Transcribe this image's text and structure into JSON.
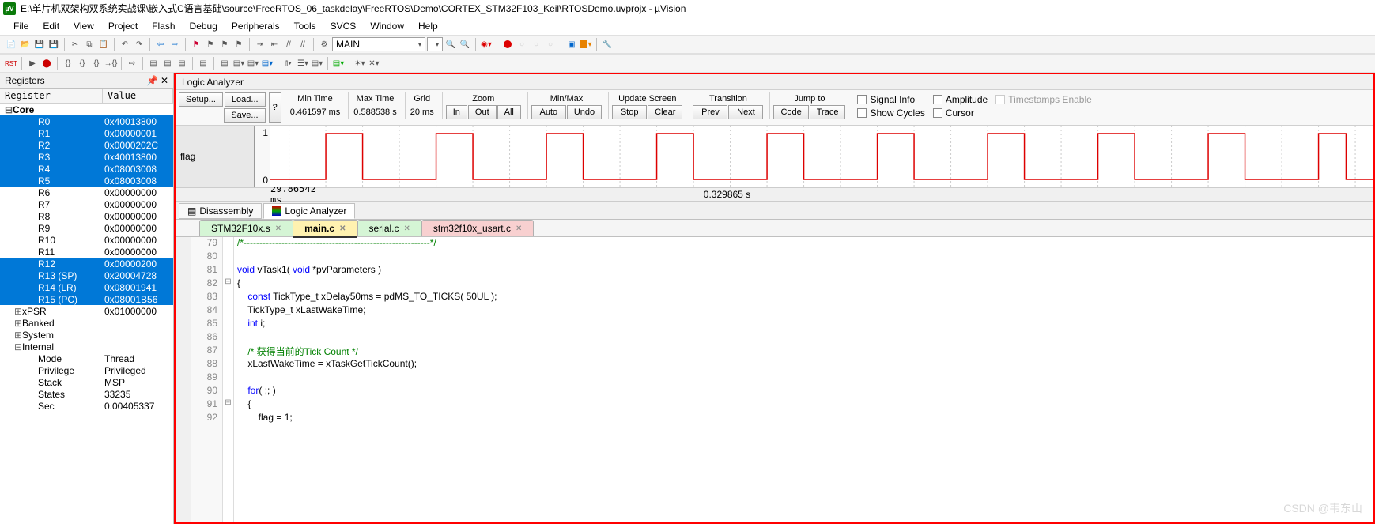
{
  "title": "E:\\单片机双架构双系统实战课\\嵌入式C语言基础\\source\\FreeRTOS_06_taskdelay\\FreeRTOS\\Demo\\CORTEX_STM32F103_Keil\\RTOSDemo.uvprojx - µVision",
  "menu": [
    "File",
    "Edit",
    "View",
    "Project",
    "Flash",
    "Debug",
    "Peripherals",
    "Tools",
    "SVCS",
    "Window",
    "Help"
  ],
  "toolbar_target": "MAIN",
  "registers_panel": {
    "title": "Registers",
    "headers": {
      "name": "Register",
      "value": "Value"
    },
    "core_label": "Core",
    "rows": [
      {
        "name": "R0",
        "value": "0x40013800",
        "sel": true
      },
      {
        "name": "R1",
        "value": "0x00000001",
        "sel": true
      },
      {
        "name": "R2",
        "value": "0x0000202C",
        "sel": true
      },
      {
        "name": "R3",
        "value": "0x40013800",
        "sel": true
      },
      {
        "name": "R4",
        "value": "0x08003008",
        "sel": true
      },
      {
        "name": "R5",
        "value": "0x08003008",
        "sel": true
      },
      {
        "name": "R6",
        "value": "0x00000000",
        "sel": false
      },
      {
        "name": "R7",
        "value": "0x00000000",
        "sel": false
      },
      {
        "name": "R8",
        "value": "0x00000000",
        "sel": false
      },
      {
        "name": "R9",
        "value": "0x00000000",
        "sel": false
      },
      {
        "name": "R10",
        "value": "0x00000000",
        "sel": false
      },
      {
        "name": "R11",
        "value": "0x00000000",
        "sel": false
      },
      {
        "name": "R12",
        "value": "0x00000200",
        "sel": true
      },
      {
        "name": "R13 (SP)",
        "value": "0x20004728",
        "sel": true
      },
      {
        "name": "R14 (LR)",
        "value": "0x08001941",
        "sel": true
      },
      {
        "name": "R15 (PC)",
        "value": "0x08001B56",
        "sel": true
      }
    ],
    "extra": [
      {
        "tree": "+",
        "name": "xPSR",
        "value": "0x01000000"
      },
      {
        "tree": "+",
        "name": "Banked",
        "value": ""
      },
      {
        "tree": "+",
        "name": "System",
        "value": ""
      },
      {
        "tree": "-",
        "name": "Internal",
        "value": ""
      }
    ],
    "internal": [
      {
        "name": "Mode",
        "value": "Thread"
      },
      {
        "name": "Privilege",
        "value": "Privileged"
      },
      {
        "name": "Stack",
        "value": "MSP"
      },
      {
        "name": "States",
        "value": "33235"
      },
      {
        "name": "Sec",
        "value": "0.00405337"
      }
    ]
  },
  "logic_analyzer": {
    "title": "Logic Analyzer",
    "buttons": {
      "setup": "Setup...",
      "load": "Load...",
      "save": "Save...",
      "help": "?"
    },
    "groups": {
      "mintime": {
        "label": "Min Time",
        "value": "0.461597 ms"
      },
      "maxtime": {
        "label": "Max Time",
        "value": "0.588538 s"
      },
      "grid": {
        "label": "Grid",
        "value": "20 ms"
      },
      "zoom": {
        "label": "Zoom",
        "btns": [
          "In",
          "Out",
          "All"
        ]
      },
      "minmax": {
        "label": "Min/Max",
        "btns": [
          "Auto",
          "Undo"
        ]
      },
      "update": {
        "label": "Update Screen",
        "btns": [
          "Stop",
          "Clear"
        ]
      },
      "transition": {
        "label": "Transition",
        "btns": [
          "Prev",
          "Next"
        ]
      },
      "jump": {
        "label": "Jump to",
        "btns": [
          "Code",
          "Trace"
        ]
      }
    },
    "checks": {
      "signal_info": "Signal Info",
      "show_cycles": "Show Cycles",
      "amplitude": "Amplitude",
      "cursor": "Cursor",
      "timestamps": "Timestamps Enable"
    },
    "signal_name": "flag",
    "axis": {
      "hi": "1",
      "lo": "0"
    },
    "time": {
      "left": "29.86542 ms",
      "mid": "0.329865 s"
    }
  },
  "bottom_tabs": {
    "disassembly": "Disassembly",
    "logic_analyzer": "Logic Analyzer"
  },
  "file_tabs": [
    {
      "label": "STM32F10x.s",
      "cls": "green"
    },
    {
      "label": "main.c",
      "cls": "yellow"
    },
    {
      "label": "serial.c",
      "cls": "green"
    },
    {
      "label": "stm32f10x_usart.c",
      "cls": "pink"
    }
  ],
  "code": {
    "start_line": 79,
    "lines": [
      {
        "n": 79,
        "html": "<span class='c-comment'>/*-----------------------------------------------------------*/</span>"
      },
      {
        "n": 80,
        "html": ""
      },
      {
        "n": 81,
        "html": "<span class='c-keyword'>void</span> vTask1( <span class='c-keyword'>void</span> *pvParameters )"
      },
      {
        "n": 82,
        "html": "{",
        "fold": "⊟"
      },
      {
        "n": 83,
        "html": "    <span class='c-keyword'>const</span> TickType_t xDelay50ms = pdMS_TO_TICKS( 50UL );"
      },
      {
        "n": 84,
        "html": "    TickType_t xLastWakeTime;"
      },
      {
        "n": 85,
        "html": "    <span class='c-keyword'>int</span> i;"
      },
      {
        "n": 86,
        "html": ""
      },
      {
        "n": 87,
        "html": "    <span class='c-comment'>/* 获得当前的Tick Count */</span>"
      },
      {
        "n": 88,
        "html": "    xLastWakeTime = xTaskGetTickCount();"
      },
      {
        "n": 89,
        "html": ""
      },
      {
        "n": 90,
        "html": "    <span class='c-keyword'>for</span>( ;; )"
      },
      {
        "n": 91,
        "html": "    {",
        "fold": "⊟"
      },
      {
        "n": 92,
        "html": "        flag = 1;"
      }
    ]
  },
  "watermark": "CSDN @韦东山",
  "chart_data": {
    "type": "line",
    "signal": "flag",
    "ylim": [
      0,
      1
    ],
    "xrange_ms": [
      29.86542,
      629.86542
    ],
    "grid_ms": 20,
    "title": "Logic Analyzer — flag",
    "pulses_ms": [
      {
        "rise": 60,
        "fall": 80
      },
      {
        "rise": 120,
        "fall": 140
      },
      {
        "rise": 180,
        "fall": 200
      },
      {
        "rise": 240,
        "fall": 260
      },
      {
        "rise": 300,
        "fall": 320
      },
      {
        "rise": 360,
        "fall": 380
      },
      {
        "rise": 420,
        "fall": 440
      },
      {
        "rise": 480,
        "fall": 500
      },
      {
        "rise": 540,
        "fall": 560
      },
      {
        "rise": 600,
        "fall": 615
      }
    ]
  }
}
